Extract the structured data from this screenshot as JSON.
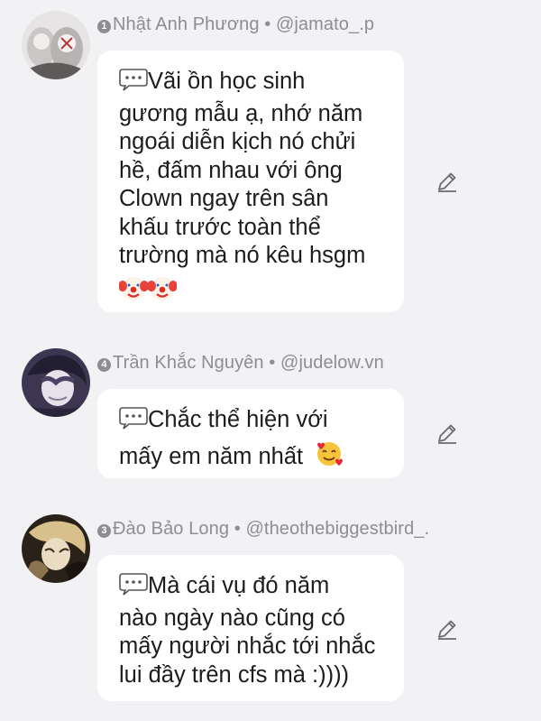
{
  "comments": [
    {
      "badge": "1",
      "author": "Nhật Anh Phương",
      "handle": "@jamato_.p",
      "separator": " • ",
      "text": "Vãi ồn học sinh\ngương mẫu ạ, nhớ năm\nngoái diễn kịch nó chửi\nhề, đấm nhau với ông\nClown ngay trên sân\nkhấu trước toàn thể\ntrường mà nó kêu hsgm",
      "prefix_icon": "speech-balloon-emoji",
      "trailing_icons": [
        "clown-face-emoji",
        "clown-face-emoji"
      ]
    },
    {
      "badge": "4",
      "author": "Trần Khắc Nguyên",
      "handle": "@judelow.vn",
      "separator": " • ",
      "text": "Chắc thể hiện với\nmấy em năm nhất",
      "prefix_icon": "speech-balloon-emoji",
      "trailing_icons": [
        "smiling-face-with-hearts-emoji"
      ]
    },
    {
      "badge": "3",
      "author": "Đào Bảo Long",
      "handle": "@theothebiggestbird_.",
      "separator": " • ",
      "text": "Mà cái vụ đó năm\nnào ngày nào cũng có\nmấy người nhắc tới nhắc\nlui đầy trên cfs mà :))))",
      "prefix_icon": "speech-balloon-emoji",
      "trailing_icons": []
    }
  ],
  "colors": {
    "background": "#f2f2f4",
    "bubble": "#ffffff",
    "meta": "#8d8d92",
    "text": "#1c1c1e"
  },
  "edit_icon": "pencil-icon"
}
